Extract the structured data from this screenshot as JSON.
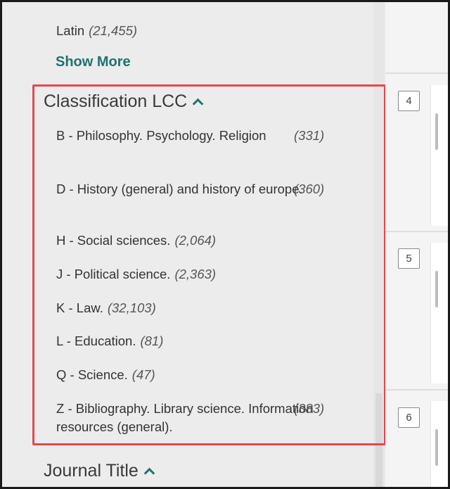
{
  "language_facet": {
    "last_item": {
      "label": "Latin",
      "count": "(21,455)"
    },
    "show_more_label": "Show More"
  },
  "classification": {
    "header": "Classification LCC",
    "items": [
      {
        "label": "B - Philosophy. Psychology. Religion",
        "count": "(331)"
      },
      {
        "label": "D - History (general) and history of europe.",
        "count": "(360)"
      },
      {
        "label": "H - Social sciences.",
        "count": "(2,064)"
      },
      {
        "label": "J - Political science.",
        "count": "(2,363)"
      },
      {
        "label": "K - Law.",
        "count": "(32,103)"
      },
      {
        "label": "L - Education.",
        "count": "(81)"
      },
      {
        "label": "Q - Science.",
        "count": "(47)"
      },
      {
        "label": "Z - Bibliography. Library science. Information resources (general).",
        "count": "(383)"
      }
    ]
  },
  "journal_title": {
    "header": "Journal Title"
  },
  "results": [
    {
      "number": "4"
    },
    {
      "number": "5"
    },
    {
      "number": "6"
    }
  ],
  "colors": {
    "accent": "#1e7371",
    "highlight": "#e5484d"
  }
}
